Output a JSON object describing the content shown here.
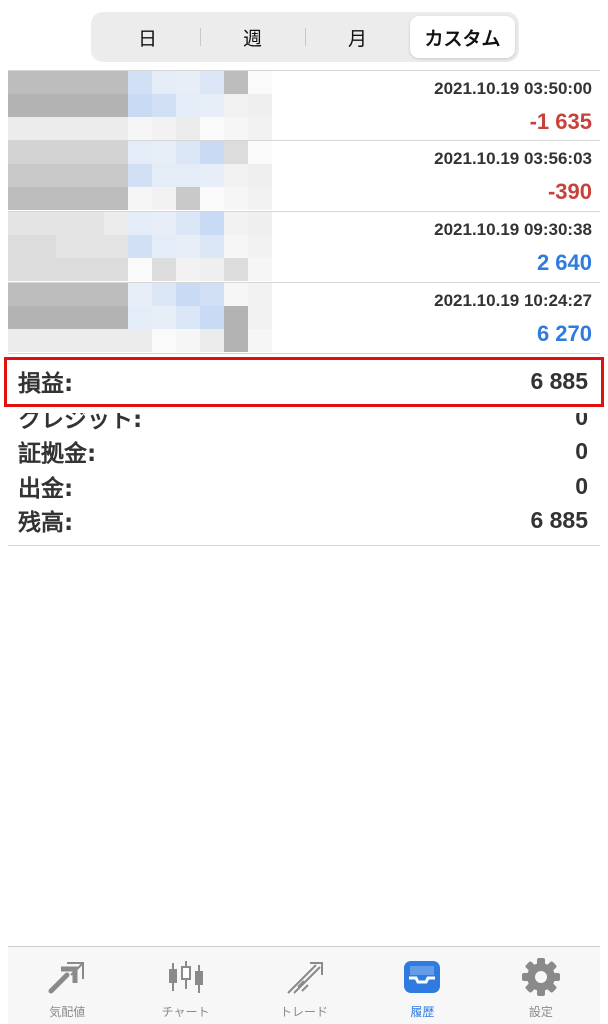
{
  "segments": [
    {
      "label": "日",
      "active": false
    },
    {
      "label": "週",
      "active": false
    },
    {
      "label": "月",
      "active": false
    },
    {
      "label": "カスタム",
      "active": true
    }
  ],
  "trades": [
    {
      "time": "2021.10.19 03:50:00",
      "amount": "-1 635",
      "sign": "neg"
    },
    {
      "time": "2021.10.19 03:56:03",
      "amount": "-390",
      "sign": "neg"
    },
    {
      "time": "2021.10.19 09:30:38",
      "amount": "2 640",
      "sign": "pos"
    },
    {
      "time": "2021.10.19 10:24:27",
      "amount": "6 270",
      "sign": "pos"
    }
  ],
  "summary": {
    "profit_label": "損益:",
    "profit_value": "6 885",
    "credit_label": "クレジット:",
    "credit_value": "0",
    "margin_label": "証拠金:",
    "margin_value": "0",
    "withdrawal_label": "出金:",
    "withdrawal_value": "0",
    "balance_label": "残高:",
    "balance_value": "6 885"
  },
  "tabs": [
    {
      "label": "気配値",
      "icon": "quotes-icon",
      "active": false
    },
    {
      "label": "チャート",
      "icon": "chart-icon",
      "active": false
    },
    {
      "label": "トレード",
      "icon": "trade-icon",
      "active": false
    },
    {
      "label": "履歴",
      "icon": "history-icon",
      "active": true
    },
    {
      "label": "設定",
      "icon": "settings-icon",
      "active": false
    }
  ],
  "colors": {
    "negative": "#c8413a",
    "positive": "#2f7be0",
    "highlight_box": "#e01010",
    "active_tab": "#2f7be0"
  }
}
